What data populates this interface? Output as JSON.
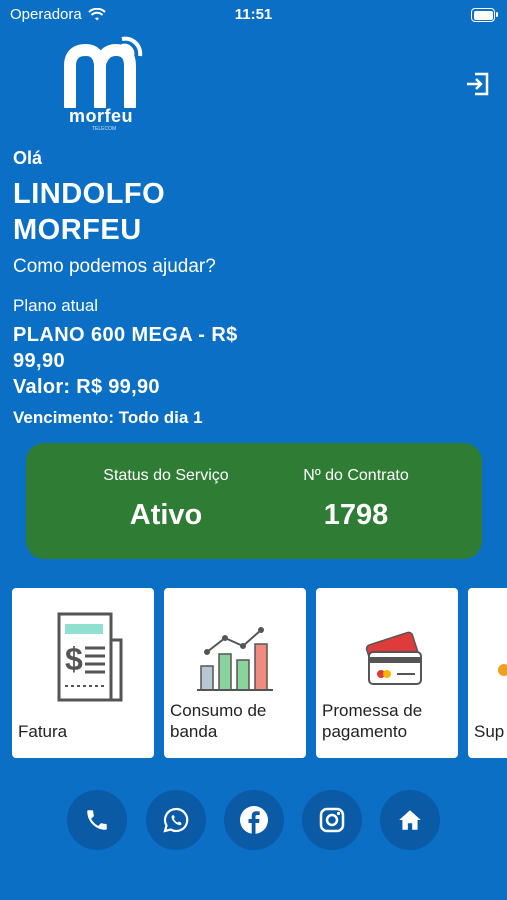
{
  "status_bar": {
    "carrier": "Operadora",
    "time": "11:51"
  },
  "logo": {
    "word": "morfeu",
    "sub": "TELECOM"
  },
  "greeting": {
    "hello": "Olá",
    "name": "LINDOLFO MORFEU",
    "help": "Como podemos ajudar?"
  },
  "plan": {
    "label": "Plano atual",
    "name": "PLANO 600 MEGA - R$ 99,90",
    "value": "Valor: R$ 99,90",
    "due": "Vencimento: Todo dia 1"
  },
  "service": {
    "status_label": "Status do Serviço",
    "status_value": "Ativo",
    "contract_label": "Nº do Contrato",
    "contract_value": "1798",
    "card_color": "#2f7d34"
  },
  "tiles": [
    {
      "label": "Fatura",
      "icon": "invoice-icon"
    },
    {
      "label": "Consumo de banda",
      "icon": "bandwidth-chart-icon"
    },
    {
      "label": "Promessa de pagamento",
      "icon": "credit-card-icon"
    },
    {
      "label": "Sup",
      "icon": "support-icon"
    }
  ],
  "nav": [
    {
      "name": "phone-icon"
    },
    {
      "name": "whatsapp-icon"
    },
    {
      "name": "facebook-icon"
    },
    {
      "name": "instagram-icon"
    },
    {
      "name": "home-icon"
    }
  ],
  "colors": {
    "background": "#0b6fc5",
    "nav_button": "#0a5aa6"
  }
}
